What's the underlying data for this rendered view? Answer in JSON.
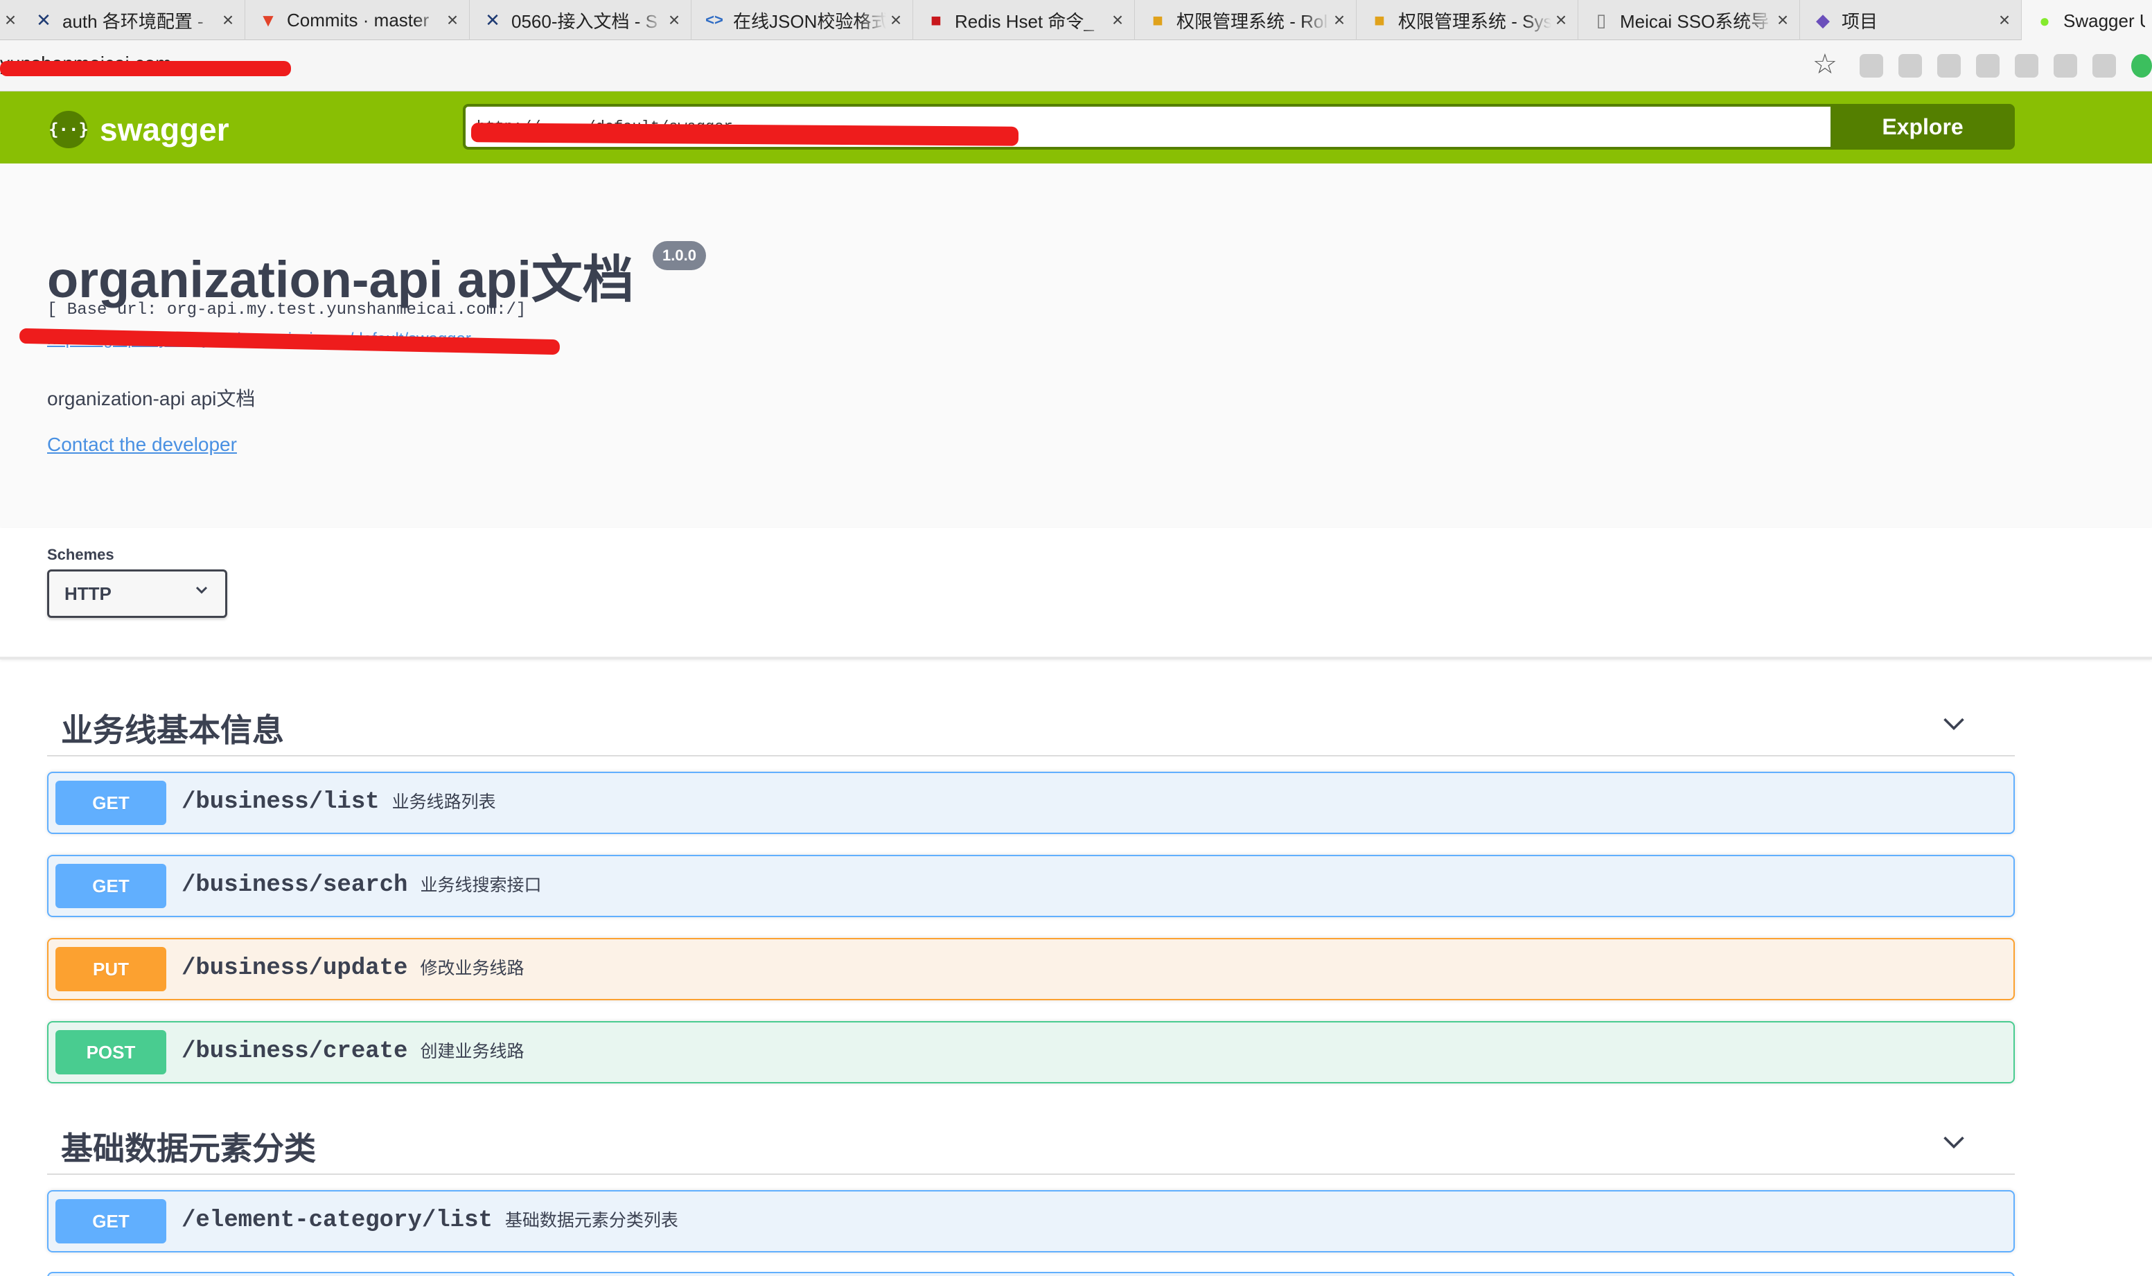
{
  "browser": {
    "tabs": [
      {
        "title": "auth 各环境配置 - "
      },
      {
        "title": "Commits · master"
      },
      {
        "title": "0560-接入文档 - S"
      },
      {
        "title": "在线JSON校验格式"
      },
      {
        "title": "Redis Hset 命令_"
      },
      {
        "title": "权限管理系统 - Rol"
      },
      {
        "title": "权限管理系统 - Sys"
      },
      {
        "title": "Meicai SSO系统导"
      },
      {
        "title": "项目"
      },
      {
        "title": "Swagger UI"
      }
    ],
    "close_glyph": "×",
    "address": "yunshanmeicai.com"
  },
  "topbar": {
    "logo_text": "swagger",
    "logo_mark": "{··}",
    "spec_url": "http://...../default/swagger",
    "explore_label": "Explore"
  },
  "info": {
    "title": "organization-api api文档",
    "version": "1.0.0",
    "base_url": "[ Base url: org-api.my.test.yunshanmeicai.com:/]",
    "spec_link": "http://org-api.my.test.yunshanmeicai.com/default/swagger",
    "description": "organization-api api文档",
    "contact": "Contact the developer"
  },
  "schemes": {
    "label": "Schemes",
    "selected": "HTTP"
  },
  "tags": [
    {
      "name": "业务线基本信息",
      "operations": [
        {
          "method": "GET",
          "path": "/business/list",
          "summary": "业务线路列表"
        },
        {
          "method": "GET",
          "path": "/business/search",
          "summary": "业务线搜索接口"
        },
        {
          "method": "PUT",
          "path": "/business/update",
          "summary": "修改业务线路"
        },
        {
          "method": "POST",
          "path": "/business/create",
          "summary": "创建业务线路"
        }
      ]
    },
    {
      "name": "基础数据元素分类",
      "operations": [
        {
          "method": "GET",
          "path": "/element-category/list",
          "summary": "基础数据元素分类列表"
        }
      ]
    }
  ],
  "colors": {
    "topbar": "#89bf04",
    "get": "#61affe",
    "put": "#fca130",
    "post": "#49cc90"
  }
}
